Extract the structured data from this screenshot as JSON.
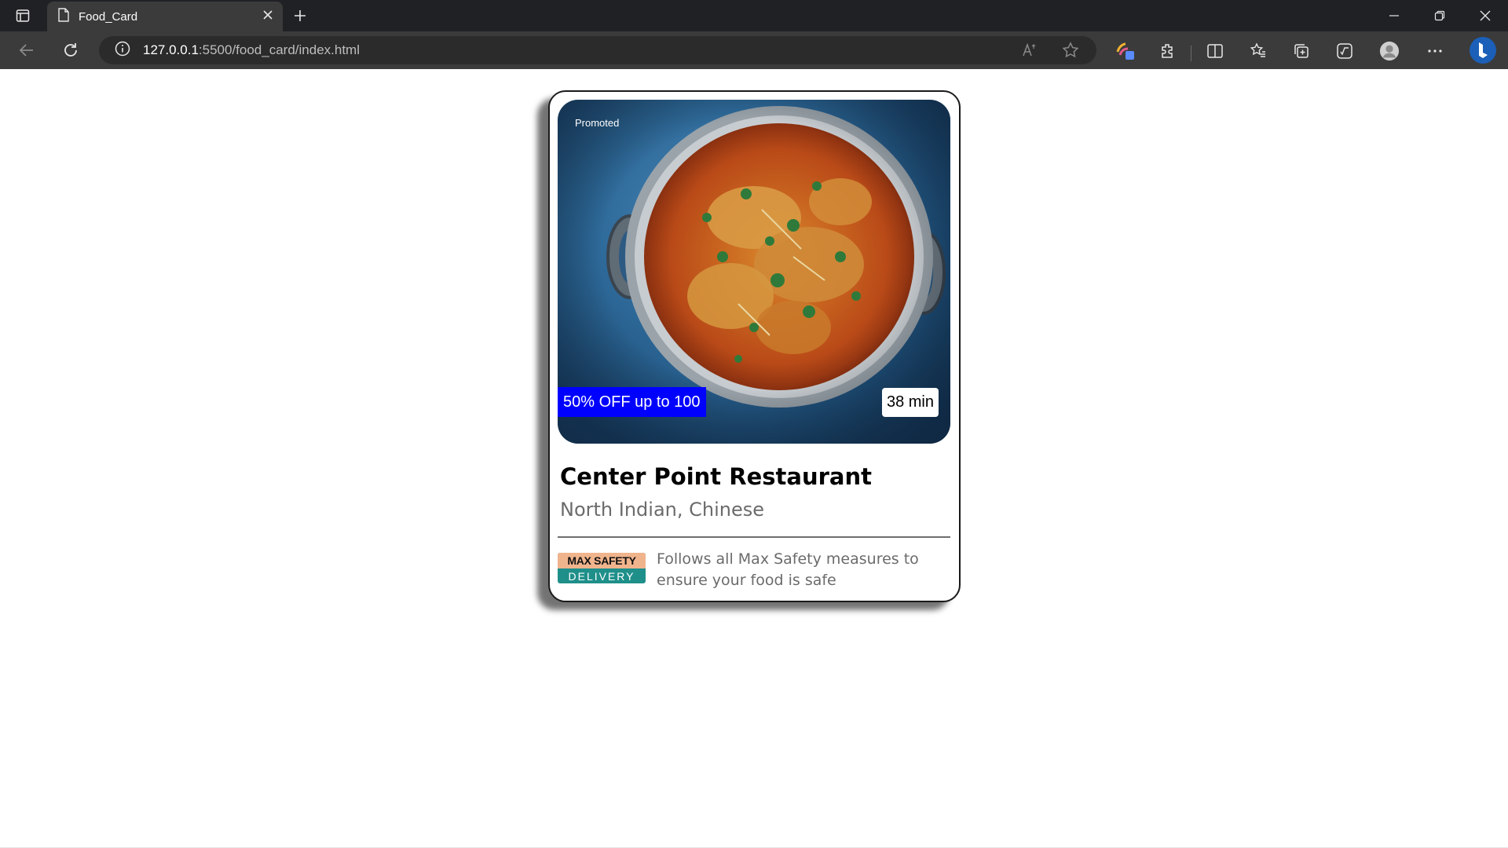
{
  "browser": {
    "tab_title": "Food_Card",
    "url_host": "127.0.0.1",
    "url_rest": ":5500/food_card/index.html"
  },
  "card": {
    "badge_promoted": "Promoted",
    "offer": "50% OFF up to 100",
    "delivery_time": "38 min",
    "restaurant_name": "Center Point Restaurant",
    "cuisine": "North Indian, Chinese",
    "safety_logo_top": "MAX SAFETY",
    "safety_logo_bottom": "DELIVERY",
    "safety_text": "Follows all Max Safety measures to ensure your food is safe"
  },
  "colors": {
    "offer_bg": "#0000ff",
    "chrome_dark": "#202124",
    "chrome_bar": "#3b3b3b"
  }
}
